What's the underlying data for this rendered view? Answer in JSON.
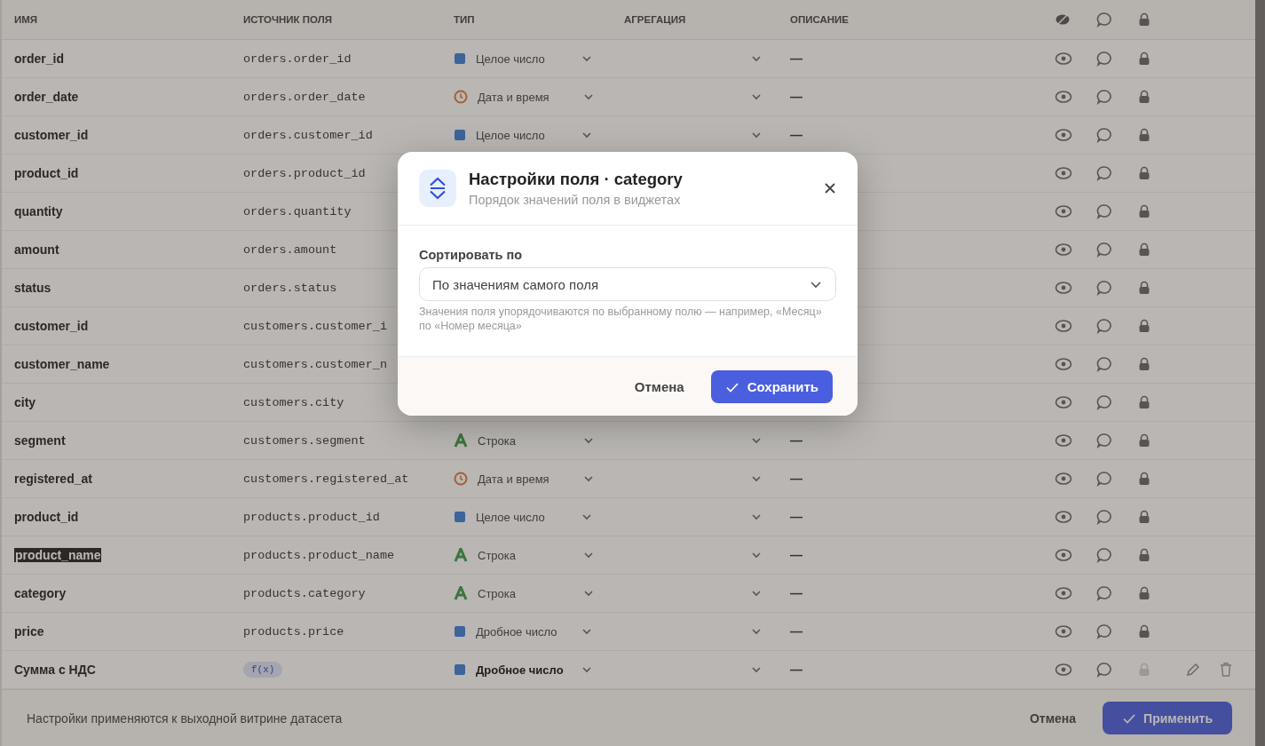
{
  "table": {
    "columns": [
      "ИМЯ",
      "ИСТОЧНИК ПОЛЯ",
      "ТИП",
      "АГРЕГАЦИЯ",
      "ОПИСАНИЕ"
    ],
    "rows": [
      {
        "name": "order_id",
        "source": "orders.order_id",
        "kind": "field",
        "selected": false,
        "type": {
          "kind": "integer",
          "label": "Целое число"
        },
        "description": "—"
      },
      {
        "name": "order_date",
        "source": "orders.order_date",
        "kind": "field",
        "selected": false,
        "type": {
          "kind": "datetime",
          "label": "Дата и время"
        },
        "description": "—"
      },
      {
        "name": "customer_id",
        "source": "orders.customer_id",
        "kind": "field",
        "selected": false,
        "type": {
          "kind": "integer",
          "label": "Целое число"
        },
        "description": "—"
      },
      {
        "name": "product_id",
        "source": "orders.product_id",
        "kind": "field",
        "selected": false
      },
      {
        "name": "quantity",
        "source": "orders.quantity",
        "kind": "field",
        "selected": false
      },
      {
        "name": "amount",
        "source": "orders.amount",
        "kind": "field",
        "selected": false
      },
      {
        "name": "status",
        "source": "orders.status",
        "kind": "field",
        "selected": false
      },
      {
        "name": "customer_id",
        "source": "customers.customer_i",
        "kind": "field",
        "selected": false
      },
      {
        "name": "customer_name",
        "source": "customers.customer_n",
        "kind": "field",
        "selected": false
      },
      {
        "name": "city",
        "source": "customers.city",
        "kind": "field",
        "selected": false
      },
      {
        "name": "segment",
        "source": "customers.segment",
        "kind": "field",
        "selected": false,
        "type": {
          "kind": "string",
          "label": "Строка"
        },
        "description": "—"
      },
      {
        "name": "registered_at",
        "source": "customers.registered_at",
        "kind": "field",
        "selected": false,
        "type": {
          "kind": "datetime",
          "label": "Дата и время"
        },
        "description": "—"
      },
      {
        "name": "product_id",
        "source": "products.product_id",
        "kind": "field",
        "selected": false,
        "type": {
          "kind": "integer",
          "label": "Целое число"
        },
        "description": "—"
      },
      {
        "name": "product_name",
        "source": "products.product_name",
        "kind": "field",
        "selected": true,
        "type": {
          "kind": "string",
          "label": "Строка"
        },
        "description": "—"
      },
      {
        "name": "category",
        "source": "products.category",
        "kind": "field",
        "selected": false,
        "type": {
          "kind": "string",
          "label": "Строка"
        },
        "description": "—"
      },
      {
        "name": "price",
        "source": "products.price",
        "kind": "field",
        "selected": false,
        "type": {
          "kind": "decimal",
          "label": "Дробное число"
        },
        "description": "—"
      },
      {
        "name": "Сумма с НДС",
        "source": "f(x)",
        "kind": "calculated",
        "selected": false,
        "type": {
          "kind": "decimal",
          "label": "Дробное число"
        },
        "description": "—"
      }
    ]
  },
  "footer": {
    "note": "Настройки применяются к выходной витрине датасета",
    "cancel": "Отмена",
    "apply": "Применить"
  },
  "dialog": {
    "title": "Настройки поля · category",
    "subtitle": "Порядок значений поля в виджетах",
    "sort_label": "Сортировать по",
    "sort_value": "По значениям самого поля",
    "hint": "Значения поля упорядочиваются по выбранному полю — например, «Месяц» по «Номер месяца»",
    "cancel": "Отмена",
    "save": "Сохранить"
  }
}
